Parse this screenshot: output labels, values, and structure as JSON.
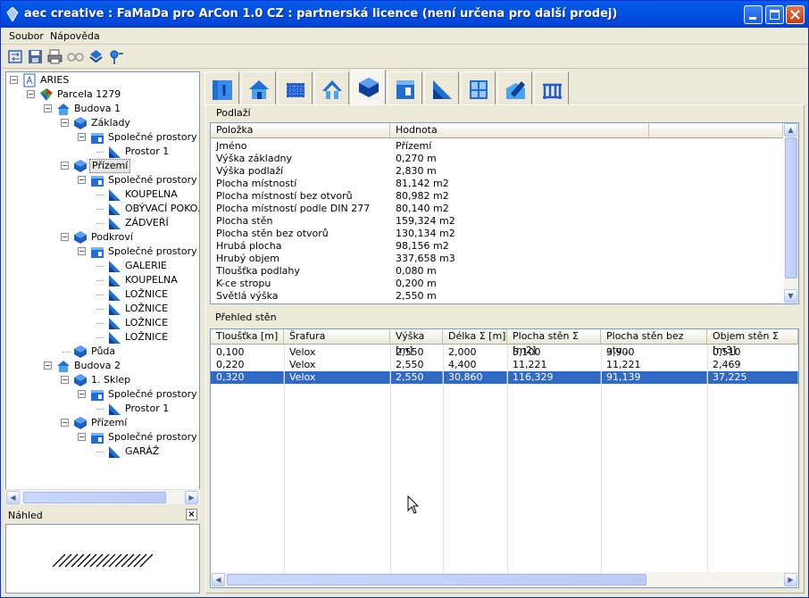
{
  "window": {
    "title": "aec creative : FaMaDa pro ArCon 1.0 CZ : partnerská licence (není určena pro další prodej)"
  },
  "menu": [
    {
      "label": "Soubor"
    },
    {
      "label": "Nápověda"
    }
  ],
  "toolbar": [
    {
      "icon": "swap-icon"
    },
    {
      "icon": "save-icon"
    },
    {
      "icon": "print-icon"
    },
    {
      "icon": "glasses-icon"
    },
    {
      "icon": "layers-icon"
    },
    {
      "icon": "pin-icon"
    }
  ],
  "tree": [
    {
      "label": "ARIES",
      "level": 0,
      "icon": "project-icon",
      "toggle": "-"
    },
    {
      "label": "Parcela 1279",
      "level": 1,
      "icon": "parcel-icon",
      "toggle": "-"
    },
    {
      "label": "Budova 1",
      "level": 2,
      "icon": "house-icon",
      "toggle": "-"
    },
    {
      "label": "Základy",
      "level": 3,
      "icon": "floor-icon",
      "toggle": "-"
    },
    {
      "label": "Společné prostory",
      "level": 4,
      "icon": "space-icon",
      "toggle": "-"
    },
    {
      "label": "Prostor 1",
      "level": 5,
      "icon": "room-icon",
      "toggle": ""
    },
    {
      "label": "Přízemí",
      "level": 3,
      "icon": "floor-icon",
      "toggle": "-",
      "selected": true
    },
    {
      "label": "Společné prostory",
      "level": 4,
      "icon": "space-icon",
      "toggle": "-"
    },
    {
      "label": "KOUPELNA",
      "level": 5,
      "icon": "room-icon",
      "toggle": ""
    },
    {
      "label": "OBÝVACÍ POKO...",
      "level": 5,
      "icon": "room-icon",
      "toggle": ""
    },
    {
      "label": "ZÁDVEŘÍ",
      "level": 5,
      "icon": "room-icon",
      "toggle": ""
    },
    {
      "label": "Podkroví",
      "level": 3,
      "icon": "floor-icon",
      "toggle": "-"
    },
    {
      "label": "Společné prostory",
      "level": 4,
      "icon": "space-icon",
      "toggle": "-"
    },
    {
      "label": "GALERIE",
      "level": 5,
      "icon": "room-icon",
      "toggle": ""
    },
    {
      "label": "KOUPELNA",
      "level": 5,
      "icon": "room-icon",
      "toggle": ""
    },
    {
      "label": "LOŽNICE",
      "level": 5,
      "icon": "room-icon",
      "toggle": ""
    },
    {
      "label": "LOŽNICE",
      "level": 5,
      "icon": "room-icon",
      "toggle": ""
    },
    {
      "label": "LOŽNICE",
      "level": 5,
      "icon": "room-icon",
      "toggle": ""
    },
    {
      "label": "LOŽNICE",
      "level": 5,
      "icon": "room-icon",
      "toggle": ""
    },
    {
      "label": "Půda",
      "level": 3,
      "icon": "floor-icon",
      "toggle": ""
    },
    {
      "label": "Budova 2",
      "level": 2,
      "icon": "house-icon",
      "toggle": "-"
    },
    {
      "label": "1. Sklep",
      "level": 3,
      "icon": "floor-icon",
      "toggle": "-"
    },
    {
      "label": "Společné prostory",
      "level": 4,
      "icon": "space-icon",
      "toggle": "-"
    },
    {
      "label": "Prostor 1",
      "level": 5,
      "icon": "room-icon",
      "toggle": ""
    },
    {
      "label": "Přízemí",
      "level": 3,
      "icon": "floor-icon",
      "toggle": "-"
    },
    {
      "label": "Společné prostory",
      "level": 4,
      "icon": "space-icon",
      "toggle": "-"
    },
    {
      "label": "GARÁŽ",
      "level": 5,
      "icon": "room-icon",
      "toggle": ""
    }
  ],
  "preview": {
    "title": "Náhled",
    "close_glyph": "×"
  },
  "tabs": [
    {
      "icon": "info-tab-icon"
    },
    {
      "icon": "house-tab-icon"
    },
    {
      "icon": "grid-tab-icon"
    },
    {
      "icon": "roof-tab-icon"
    },
    {
      "icon": "floor-tab-icon",
      "active": true
    },
    {
      "icon": "door-tab-icon"
    },
    {
      "icon": "stair-tab-icon"
    },
    {
      "icon": "window-tab-icon"
    },
    {
      "icon": "edit-tab-icon"
    },
    {
      "icon": "railing-tab-icon"
    }
  ],
  "props": {
    "group_title": "Podlaží",
    "headers": [
      "Položka",
      "Hodnota"
    ],
    "rows": [
      [
        "Jméno",
        "Přízemí"
      ],
      [
        "Výška základny",
        "0,270 m"
      ],
      [
        "Výška podlaží",
        "2,830 m"
      ],
      [
        "Plocha místností",
        "81,142 m2"
      ],
      [
        "Plocha místností bez otvorů",
        "80,982 m2"
      ],
      [
        "Plocha místností podle DIN 277",
        "80,140 m2"
      ],
      [
        "Plocha stěn",
        "159,324 m2"
      ],
      [
        "Plocha stěn bez otvorů",
        "130,134 m2"
      ],
      [
        "Hrubá plocha",
        "98,156 m2"
      ],
      [
        "Hrubý objem",
        "337,658 m3"
      ],
      [
        "Tloušťka podlahy",
        "0,080 m"
      ],
      [
        "K-ce stropu",
        "0,200 m"
      ],
      [
        "Světlá výška",
        "2,550 m"
      ]
    ]
  },
  "walls": {
    "title": "Přehled stěn",
    "headers": [
      "Tloušťka [m]",
      "Šrafura",
      "Výška [m]",
      "Délka Σ [m]",
      "Plocha stěn Σ [m2]",
      "Plocha stěn bez otv...",
      "Objem stěn Σ [m3]"
    ],
    "rows": [
      [
        "0,100",
        "Velox",
        "2,550",
        "2,000",
        "5,100",
        "3,900",
        "0,510"
      ],
      [
        "0,220",
        "Velox",
        "2,550",
        "4,400",
        "11,221",
        "11,221",
        "2,469"
      ],
      [
        "0,320",
        "Velox",
        "2,550",
        "30,860",
        "116,329",
        "91,139",
        "37,225"
      ]
    ],
    "selected_row": 2
  },
  "colors": {
    "selection": "#316ac5",
    "titlebar": "#0054e3"
  }
}
